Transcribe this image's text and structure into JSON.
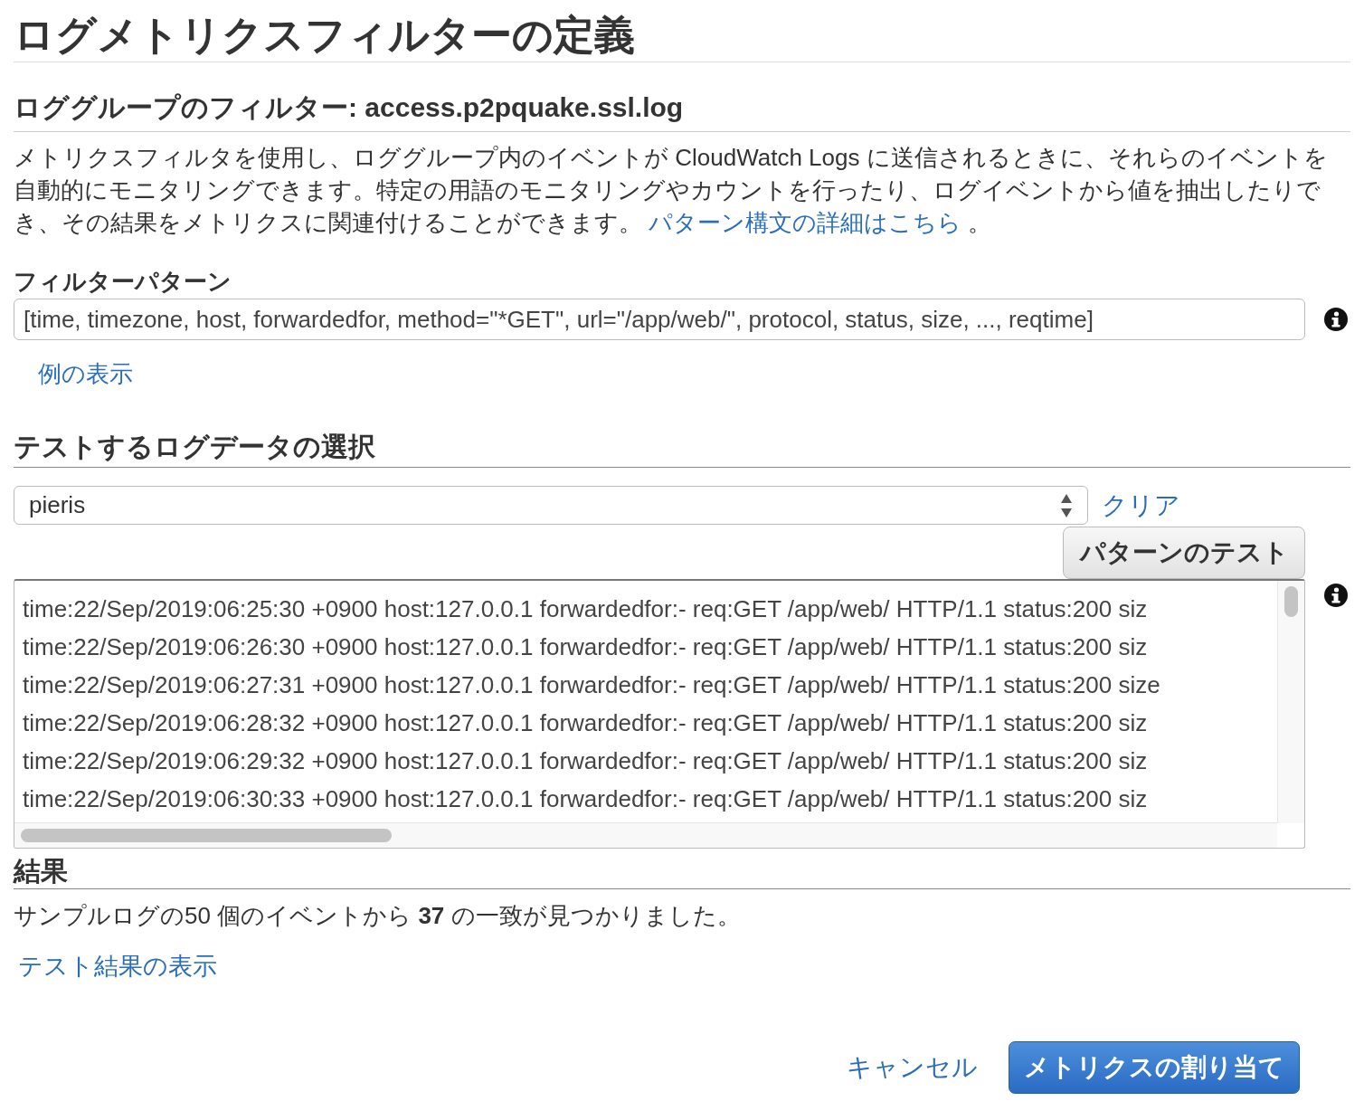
{
  "page": {
    "title": "ログメトリクスフィルターの定義"
  },
  "log_group": {
    "heading": "ロググループのフィルター: access.p2pquake.ssl.log"
  },
  "description": {
    "text": "メトリクスフィルタを使用し、ロググループ内のイベントが CloudWatch Logs に送信されるときに、それらのイベントを自動的にモニタリングできます。特定の用語のモニタリングやカウントを行ったり、ログイベントから値を抽出したりでき、その結果をメトリクスに関連付けることができます。",
    "link": "パターン構文の詳細はこちら",
    "suffix": " 。"
  },
  "filter_pattern": {
    "label": "フィルターパターン",
    "value": "[time, timezone, host, forwardedfor, method=\"*GET\", url=\"/app/web/\", protocol, status, size, ..., reqtime]",
    "examples_link": "例の表示"
  },
  "test_data": {
    "heading": "テストするログデータの選択",
    "select_value": "pieris",
    "clear_link": "クリア",
    "test_button": "パターンのテスト",
    "log_lines": [
      "time:22/Sep/2019:06:25:30 +0900 host:127.0.0.1 forwardedfor:- req:GET /app/web/ HTTP/1.1 status:200 siz",
      "time:22/Sep/2019:06:26:30 +0900 host:127.0.0.1 forwardedfor:- req:GET /app/web/ HTTP/1.1 status:200 siz",
      "time:22/Sep/2019:06:27:31 +0900 host:127.0.0.1 forwardedfor:- req:GET /app/web/ HTTP/1.1 status:200 size",
      "time:22/Sep/2019:06:28:32 +0900 host:127.0.0.1 forwardedfor:- req:GET /app/web/ HTTP/1.1 status:200 siz",
      "time:22/Sep/2019:06:29:32 +0900 host:127.0.0.1 forwardedfor:- req:GET /app/web/ HTTP/1.1 status:200 siz",
      "time:22/Sep/2019:06:30:33 +0900 host:127.0.0.1 forwardedfor:- req:GET /app/web/ HTTP/1.1 status:200 siz"
    ]
  },
  "results": {
    "heading": "結果",
    "summary": "サンプルログの50 個のイベントから **37** の一致が見つかりました。",
    "link": "テスト結果の表示"
  },
  "footer": {
    "cancel": "キャンセル",
    "assign_button": "メトリクスの割り当て"
  }
}
